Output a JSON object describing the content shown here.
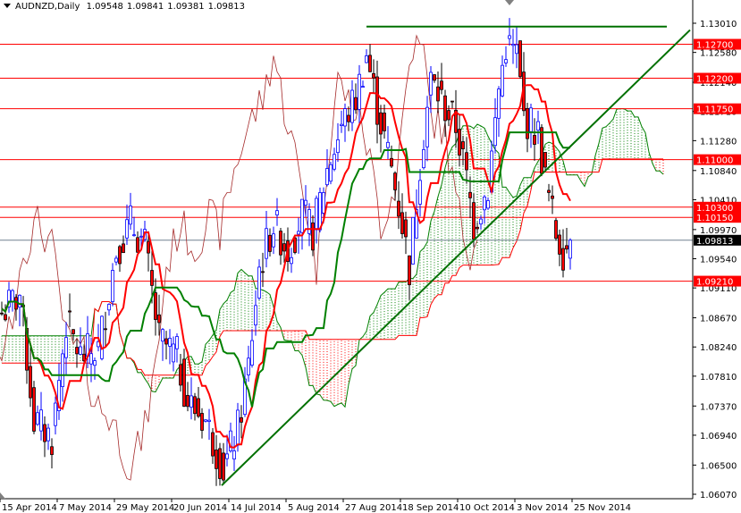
{
  "header": {
    "symbol": "AUDNZD,Daily",
    "open": "1.09548",
    "high": "1.09841",
    "low": "1.09381",
    "close": "1.09813"
  },
  "colors": {
    "bull": "#0000ff",
    "bear_body": "#ff0000",
    "tenkan": "#ff0000",
    "kijun": "#008000",
    "chikou": "#a52a2a",
    "cloud_up": "#008000",
    "cloud_down": "#ff0000",
    "level": "#ff0000",
    "trend": "#007000",
    "current": "#000000"
  },
  "chart_data": {
    "type": "candlestick",
    "title": "AUDNZD,Daily",
    "indicator": "Ichimoku Kinko Hyo (9,26,52)",
    "ylim": [
      1.0607,
      1.131
    ],
    "y_ticks": [
      "1.13010",
      "1.12580",
      "1.12140",
      "1.11710",
      "1.11280",
      "1.10840",
      "1.10410",
      "1.09970",
      "1.09540",
      "1.09110",
      "1.08670",
      "1.08240",
      "1.07810",
      "1.07370",
      "1.06940",
      "1.06500",
      "1.06070"
    ],
    "x_ticks": [
      {
        "bar": 0,
        "label": "15 Apr 2014"
      },
      {
        "bar": 16,
        "label": "7 May 2014"
      },
      {
        "bar": 32,
        "label": "29 May 2014"
      },
      {
        "bar": 48,
        "label": "20 Jun 2014"
      },
      {
        "bar": 64,
        "label": "14 Jul 2014"
      },
      {
        "bar": 80,
        "label": "5 Aug 2014"
      },
      {
        "bar": 96,
        "label": "27 Aug 2014"
      },
      {
        "bar": 112,
        "label": "18 Sep 2014"
      },
      {
        "bar": 128,
        "label": "10 Oct 2014"
      },
      {
        "bar": 144,
        "label": "3 Nov 2014"
      },
      {
        "bar": 160,
        "label": "25 Nov 2014"
      }
    ],
    "close_anchors": [
      [
        0,
        1.0874
      ],
      [
        5,
        1.0901
      ],
      [
        9,
        1.0716
      ],
      [
        14,
        1.069
      ],
      [
        18,
        1.086
      ],
      [
        22,
        1.081
      ],
      [
        27,
        1.082
      ],
      [
        32,
        1.0967
      ],
      [
        36,
        1.1006
      ],
      [
        40,
        1.0973
      ],
      [
        44,
        1.0835
      ],
      [
        49,
        1.081
      ],
      [
        52,
        1.0743
      ],
      [
        57,
        1.0716
      ],
      [
        62,
        1.0644
      ],
      [
        66,
        1.0703
      ],
      [
        69,
        1.0795
      ],
      [
        72,
        1.094
      ],
      [
        76,
        1.1006
      ],
      [
        80,
        1.0967
      ],
      [
        84,
        1.1019
      ],
      [
        87,
        1.0993
      ],
      [
        91,
        1.1085
      ],
      [
        95,
        1.1151
      ],
      [
        99,
        1.119
      ],
      [
        102,
        1.1256
      ],
      [
        105,
        1.1177
      ],
      [
        109,
        1.1085
      ],
      [
        112,
        1.1006
      ],
      [
        114,
        1.094
      ],
      [
        117,
        1.1098
      ],
      [
        120,
        1.1217
      ],
      [
        124,
        1.1177
      ],
      [
        127,
        1.1151
      ],
      [
        130,
        1.107
      ],
      [
        132,
        1.1006
      ],
      [
        136,
        1.1059
      ],
      [
        139,
        1.1204
      ],
      [
        141,
        1.127
      ],
      [
        144,
        1.1256
      ],
      [
        146,
        1.1164
      ],
      [
        150,
        1.1138
      ],
      [
        152,
        1.107
      ],
      [
        155,
        1.0993
      ],
      [
        157,
        1.0967
      ],
      [
        159,
        1.0981
      ]
    ],
    "levels": [
      {
        "price": 1.127,
        "label": "1.12700"
      },
      {
        "price": 1.122,
        "label": "1.12200"
      },
      {
        "price": 1.1175,
        "label": "1.11750"
      },
      {
        "price": 1.11,
        "label": "1.11000"
      },
      {
        "price": 1.103,
        "label": "1.10300"
      },
      {
        "price": 1.1015,
        "label": "1.10150"
      },
      {
        "price": 1.0921,
        "label": "1.09210"
      }
    ],
    "current_price": {
      "price": 1.09813,
      "label": "1.09813"
    },
    "resistance_line": {
      "price": 1.1296,
      "from_bar": 102,
      "to_bar": 186
    },
    "trendline": {
      "from": [
        61.5,
        1.062
      ],
      "to": [
        192.5,
        1.1291
      ]
    }
  }
}
